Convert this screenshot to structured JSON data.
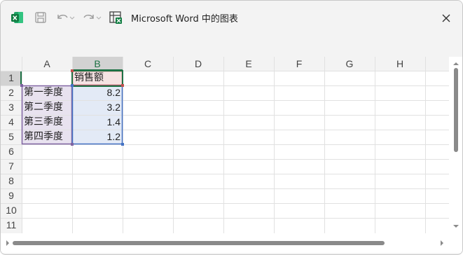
{
  "window": {
    "title": "Microsoft Word 中的图表"
  },
  "toolbar": {
    "icons": [
      "excel-logo-icon",
      "save-icon",
      "undo-icon",
      "redo-icon",
      "edit-data-in-excel-icon",
      "close-icon"
    ]
  },
  "sheet": {
    "columns": [
      "A",
      "B",
      "C",
      "D",
      "E",
      "F",
      "G",
      "H"
    ],
    "rows": [
      "1",
      "2",
      "3",
      "4",
      "5",
      "6",
      "7",
      "8",
      "9",
      "10",
      "11"
    ],
    "selected_column": "B",
    "selected_row": "1",
    "header": {
      "b1": "销售额"
    },
    "categories": [
      "第一季度",
      "第二季度",
      "第三季度",
      "第四季度"
    ],
    "values": [
      "8.2",
      "3.2",
      "1.4",
      "1.2"
    ],
    "colors": {
      "series_range": "#c0504d",
      "category_range": "#8064a2",
      "values_range": "#4472c4",
      "selected_header": "#1e7145"
    }
  }
}
